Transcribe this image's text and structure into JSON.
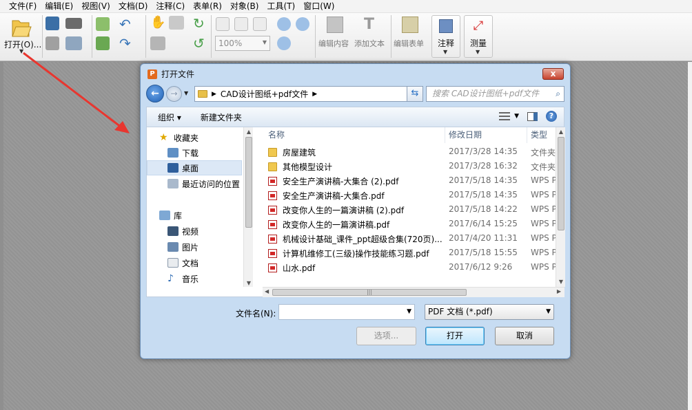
{
  "menu": [
    "文件(F)",
    "编辑(E)",
    "视图(V)",
    "文档(D)",
    "注释(C)",
    "表单(R)",
    "对象(B)",
    "工具(T)",
    "窗口(W)"
  ],
  "toolbar": {
    "open_label": "打开(O)...",
    "zoom_value": "100%",
    "edit_content_label": "编辑内容",
    "add_text_label": "添加文本",
    "edit_form_label": "编辑表单",
    "comment_label": "注释",
    "measure_label": "测量"
  },
  "dialog": {
    "title": "打开文件",
    "close_glyph": "x",
    "address": {
      "folder": "CAD设计图纸+pdf文件"
    },
    "search_placeholder": "搜索 CAD设计图纸+pdf文件",
    "commands": {
      "organize": "组织 ▾",
      "new_folder": "新建文件夹"
    },
    "nav": {
      "favorites": "收藏夹",
      "downloads": "下载",
      "desktop": "桌面",
      "recent": "最近访问的位置",
      "libraries": "库",
      "videos": "视频",
      "pictures": "图片",
      "documents": "文档",
      "music": "音乐"
    },
    "columns": {
      "name": "名称",
      "modified": "修改日期",
      "type": "类型"
    },
    "files": [
      {
        "name": "房屋建筑",
        "date": "2017/3/28 14:35",
        "type": "文件夹",
        "kind": "folder"
      },
      {
        "name": "其他模型设计",
        "date": "2017/3/28 16:32",
        "type": "文件夹",
        "kind": "folder"
      },
      {
        "name": "安全生产演讲稿-大集合 (2).pdf",
        "date": "2017/5/18 14:35",
        "type": "WPS PDF",
        "kind": "pdf"
      },
      {
        "name": "安全生产演讲稿-大集合.pdf",
        "date": "2017/5/18 14:35",
        "type": "WPS PDF",
        "kind": "pdf"
      },
      {
        "name": "改变你人生的一篇演讲稿 (2).pdf",
        "date": "2017/5/18 14:22",
        "type": "WPS PDF",
        "kind": "pdf"
      },
      {
        "name": "改变你人生的一篇演讲稿.pdf",
        "date": "2017/6/14 15:25",
        "type": "WPS PDF",
        "kind": "pdf"
      },
      {
        "name": "机械设计基础_课件_ppt超级合集(720页)...",
        "date": "2017/4/20 11:31",
        "type": "WPS PDF",
        "kind": "pdf"
      },
      {
        "name": "计算机维修工(三级)操作技能练习题.pdf",
        "date": "2017/5/18 15:55",
        "type": "WPS PDF",
        "kind": "pdf"
      },
      {
        "name": "山水.pdf",
        "date": "2017/6/12 9:26",
        "type": "WPS PDF",
        "kind": "pdf"
      }
    ],
    "filename_label": "文件名(N):",
    "filename_value": "",
    "filetype": "PDF 文档 (*.pdf)",
    "buttons": {
      "options": "选项...",
      "open": "打开",
      "cancel": "取消"
    }
  },
  "colors": {
    "dialog_frame": "#c7dcf2",
    "annotation_arrow": "#e8362f",
    "close_button": "#c7432e"
  }
}
